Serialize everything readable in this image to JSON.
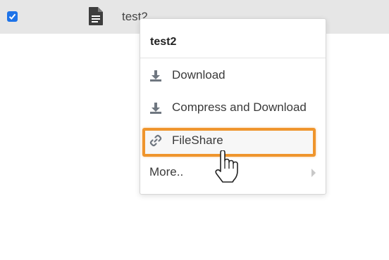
{
  "file": {
    "name": "test2",
    "checked": true
  },
  "menu": {
    "title": "test2",
    "items": [
      {
        "label": "Download",
        "icon": "download-icon"
      },
      {
        "label": "Compress and Download",
        "icon": "download-icon"
      },
      {
        "label": "FileShare",
        "icon": "link-icon",
        "highlighted": true
      },
      {
        "label": "More..",
        "icon": "chevron-right-icon",
        "disabled": true
      }
    ]
  },
  "colors": {
    "row_bg": "#e6e6e6",
    "checkbox": "#1e73e8",
    "highlight_border": "#ef952d",
    "icon_gray": "#6f7780"
  },
  "cursor": "hand-pointer-icon"
}
